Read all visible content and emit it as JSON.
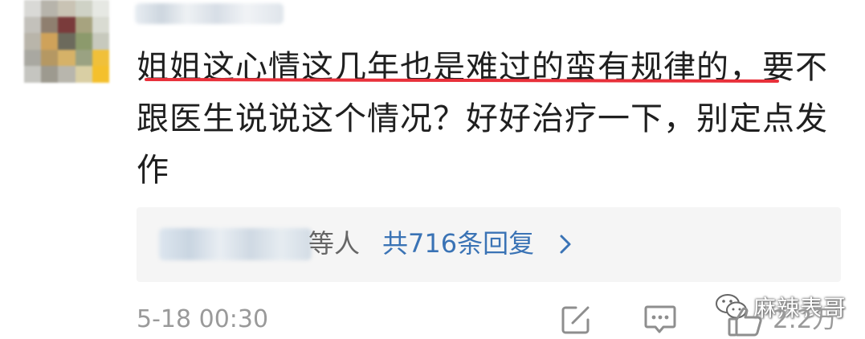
{
  "comment": {
    "text": "姐姐这心情这几年也是难过的蛮有规律的，要不跟医生说说这个情况？好好治疗一下，别定点发作",
    "underline_color": "#e8303a"
  },
  "replies": {
    "suffix": "等人",
    "count_label": "共716条回复",
    "count_color": "#3a73b5",
    "chevron_icon": "chevron-right-icon"
  },
  "footer": {
    "timestamp": "5-18 00:30",
    "share_icon": "edit-share-icon",
    "comment_icon": "comment-icon",
    "like_icon": "thumbs-up-icon",
    "likes": "2.2万"
  },
  "watermark": {
    "text": "麻辣表哥",
    "icon": "wechat-icon"
  }
}
